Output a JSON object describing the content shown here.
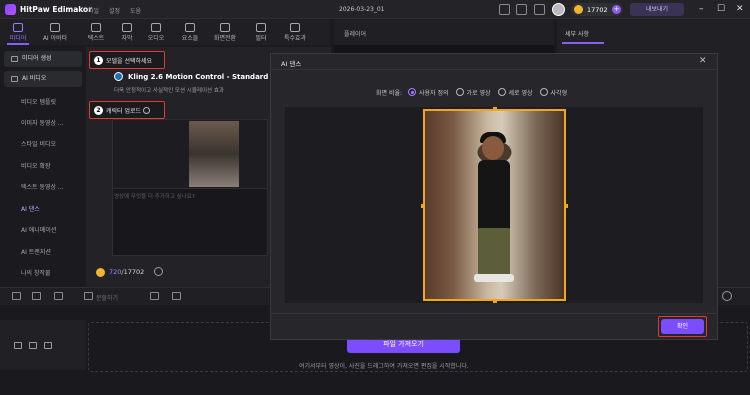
{
  "app": {
    "name": "HitPaw Edimakor",
    "menu": [
      "파일",
      "설정",
      "도움"
    ],
    "doc_title": "2026-03-23_01",
    "credits": "17702",
    "export_label": "내보내기"
  },
  "toolbar": {
    "tools": [
      "미디어",
      "AI 아바타",
      "텍스트",
      "자막",
      "오디오",
      "요소들",
      "화면전환",
      "필터",
      "특수효과"
    ],
    "active": "미디어"
  },
  "leftnav": {
    "media_header": "미디어 생성",
    "ai_video_header": "AI 비디오",
    "items": [
      "비디오 템플릿",
      "이미지 동영상 ...",
      "스타일 비디오",
      "비디오 확장",
      "텍스트 동영상 ...",
      "AI 댄스",
      "AI 애니메이션",
      "AI 트랜지션",
      "나의 창작물"
    ],
    "active_item": "AI 댄스"
  },
  "center": {
    "step1_label": "모델을 선택하세요",
    "step2_label": "캐릭터 업로드",
    "model_name": "Kling 2.6 Motion Control - Standard",
    "model_desc": "더욱 안정적이고 사실적인 모션 시뮬레이션 효과",
    "prompt_placeholder": "영상에 무엇을 더 추가하고 싶나요?",
    "cost_used": "720",
    "cost_total": "/17702"
  },
  "player": {
    "label": "플레이어"
  },
  "right_panel": {
    "tab": "세부 사항"
  },
  "timeline": {
    "split_label": "분할하기",
    "import_label": "파일 가져오기",
    "drop_hint": "여기서부터 영상이, 사진을 드래그하여 가져오면 편집을 시작합니다."
  },
  "modal": {
    "title": "AI 댄스",
    "ratio_label": "화면 비율:",
    "ratios": [
      "사용자 정의",
      "가로 영상",
      "세로 영상",
      "사각형"
    ],
    "selected_ratio": "사용자 정의",
    "confirm_label": "확인"
  },
  "colors": {
    "accent": "#7c4dff",
    "highlight_box": "#e53935",
    "crop_frame": "#f0a81a"
  }
}
